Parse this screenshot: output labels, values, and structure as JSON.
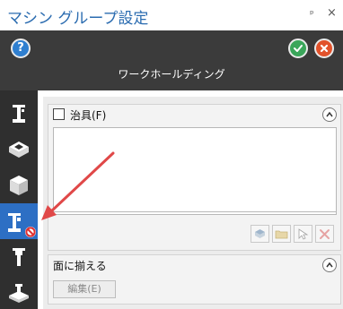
{
  "window": {
    "title": "マシン グループ設定",
    "pin_glyph": "ᵖ",
    "close_glyph": "×"
  },
  "header": {
    "panel_title": "ワークホールディング",
    "help_glyph": "?"
  },
  "sidebar": {
    "items": [
      {
        "icon": "clamp-icon"
      },
      {
        "icon": "stock-icon"
      },
      {
        "icon": "part-icon"
      },
      {
        "icon": "workholding-icon",
        "active": true
      },
      {
        "icon": "tool-icon"
      },
      {
        "icon": "machine-icon"
      }
    ]
  },
  "fixture_section": {
    "label": "治具(F)",
    "checked": false,
    "toolbar": [
      "add-fixture",
      "open-folder",
      "select-geometry",
      "remove"
    ]
  },
  "align_section": {
    "label": "面に揃える",
    "edit_label": "編集(E)"
  },
  "colors": {
    "accent": "#2d6fc4",
    "title_blue": "#2b6cb0",
    "annotation_arrow": "#e04848"
  }
}
